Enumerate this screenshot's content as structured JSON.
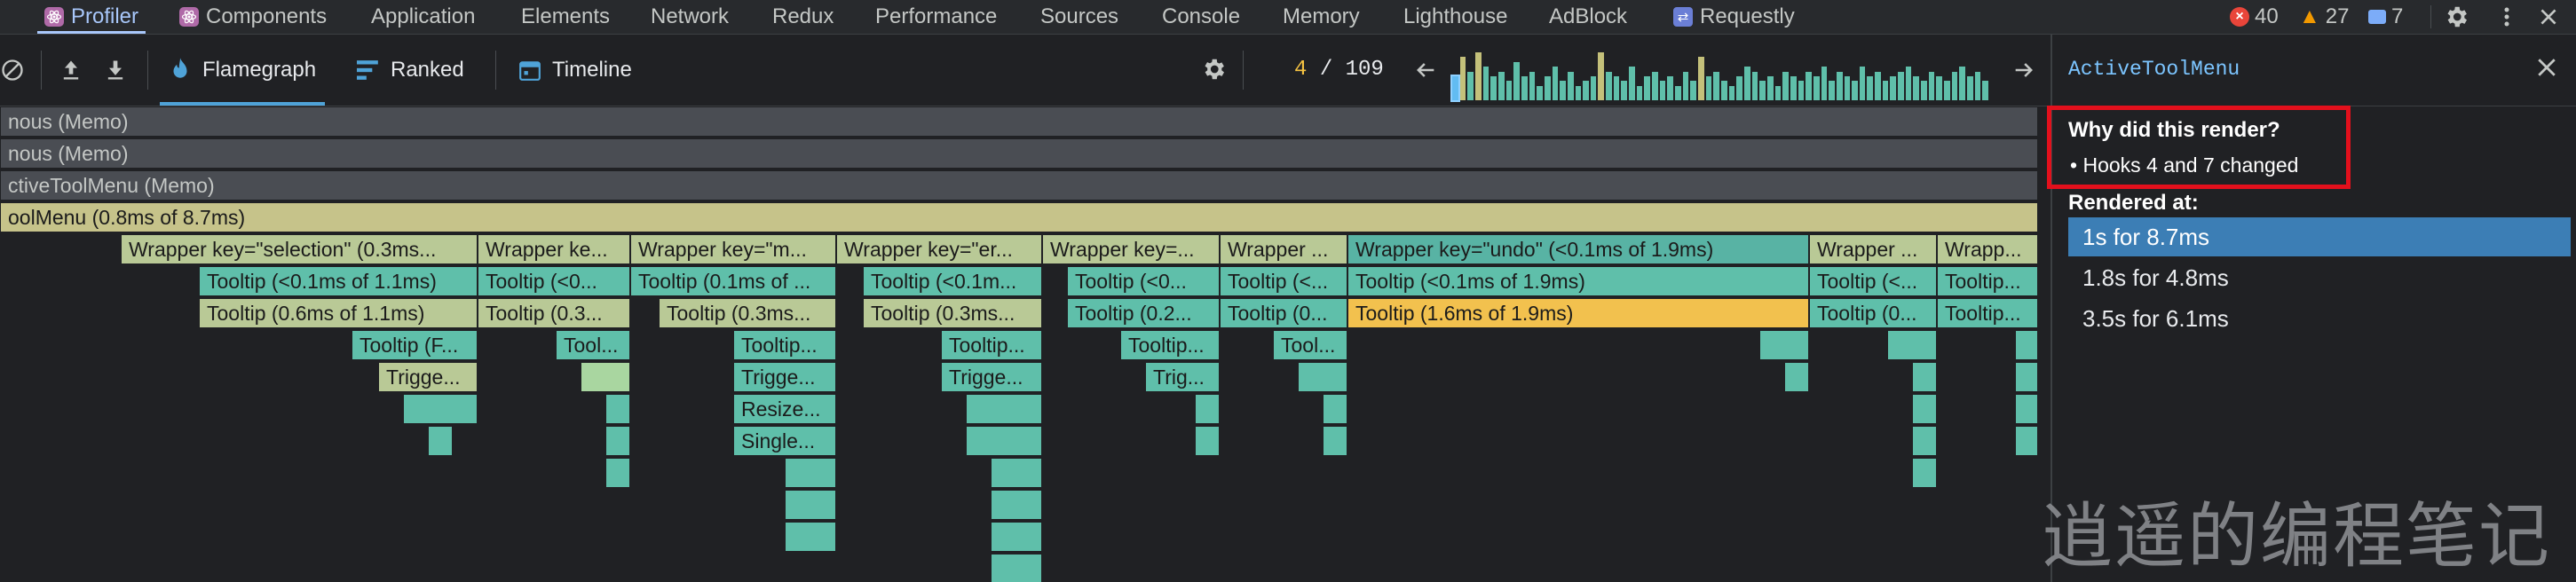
{
  "devtools_tabs": [
    {
      "label": "Profiler",
      "icon": "react-icon",
      "active": true
    },
    {
      "label": "Components",
      "icon": "react-icon",
      "active": false
    },
    {
      "label": "Application",
      "active": false
    },
    {
      "label": "Elements",
      "active": false
    },
    {
      "label": "Network",
      "active": false
    },
    {
      "label": "Redux",
      "active": false
    },
    {
      "label": "Performance",
      "active": false
    },
    {
      "label": "Sources",
      "active": false
    },
    {
      "label": "Console",
      "active": false
    },
    {
      "label": "Memory",
      "active": false
    },
    {
      "label": "Lighthouse",
      "active": false
    },
    {
      "label": "AdBlock",
      "active": false
    },
    {
      "label": "Requestly",
      "icon": "requestly-icon",
      "active": false
    }
  ],
  "status": {
    "errors": "40",
    "warnings": "27",
    "messages": "7"
  },
  "toolbar": {
    "flamegraph_label": "Flamegraph",
    "ranked_label": "Ranked",
    "timeline_label": "Timeline",
    "commit_current": "4",
    "commit_total": "/ 109",
    "commit_bars": [
      0.5,
      0.9,
      0.6,
      1.0,
      0.7,
      0.5,
      0.6,
      0.4,
      0.8,
      0.5,
      0.6,
      0.3,
      0.5,
      0.7,
      0.4,
      0.6,
      0.3,
      0.4,
      0.5,
      1.0,
      0.6,
      0.5,
      0.4,
      0.7,
      0.3,
      0.5,
      0.6,
      0.4,
      0.5,
      0.3,
      0.6,
      0.4,
      0.9,
      0.5,
      0.6,
      0.4,
      0.3,
      0.5,
      0.7,
      0.6,
      0.4,
      0.5,
      0.3,
      0.6,
      0.5,
      0.4,
      0.6,
      0.5,
      0.7,
      0.4,
      0.6,
      0.5,
      0.4,
      0.7,
      0.5,
      0.6,
      0.4,
      0.5,
      0.6,
      0.7,
      0.5,
      0.4,
      0.6,
      0.5,
      0.4,
      0.6,
      0.7,
      0.5,
      0.6,
      0.4
    ]
  },
  "flamegraph": {
    "rows": [
      [
        "nous (Memo)"
      ],
      [
        "nous (Memo)"
      ],
      [
        "ctiveToolMenu (Memo)"
      ],
      [
        "oolMenu (0.8ms of 8.7ms)"
      ],
      [
        "Wrapper key=\"selection\" (0.3ms...",
        "Wrapper ke...",
        "Wrapper key=\"m...",
        "Wrapper key=\"er...",
        "Wrapper key=...",
        "Wrapper ...",
        "Wrapper key=\"undo\" (<0.1ms of 1.9ms)",
        "Wrapper ...",
        "Wrapp..."
      ],
      [
        "Tooltip (<0.1ms of 1.1ms)",
        "Tooltip (<0...",
        "Tooltip (0.1ms of ...",
        "Tooltip (<0.1m...",
        "Tooltip (<0...",
        "Tooltip (<...",
        "Tooltip (<0.1ms of 1.9ms)",
        "Tooltip (<...",
        "Tooltip..."
      ],
      [
        "Tooltip (0.6ms of 1.1ms)",
        "Tooltip (0.3...",
        "Tooltip (0.3ms...",
        "Tooltip (0.3ms...",
        "Tooltip (0.2...",
        "Tooltip (0...",
        "Tooltip (1.6ms of 1.9ms)",
        "Tooltip (0...",
        "Tooltip..."
      ],
      [
        "Tooltip (F...",
        "Tool...",
        "Tooltip...",
        "Tooltip...",
        "Tooltip...",
        "Tool..."
      ],
      [
        "Trigge...",
        "Trigge...",
        "Trigge...",
        "Trig..."
      ],
      [
        "Resize..."
      ],
      [
        "Single..."
      ]
    ]
  },
  "sidebar": {
    "title": "ActiveToolMenu",
    "why_title": "Why did this render?",
    "why_reason": "Hooks 4 and 7 changed",
    "rendered_title": "Rendered at:",
    "rendered_items": [
      "1s for 8.7ms",
      "1.8s for 4.8ms",
      "3.5s for 6.1ms"
    ]
  },
  "watermark": "逍遥的编程笔记"
}
